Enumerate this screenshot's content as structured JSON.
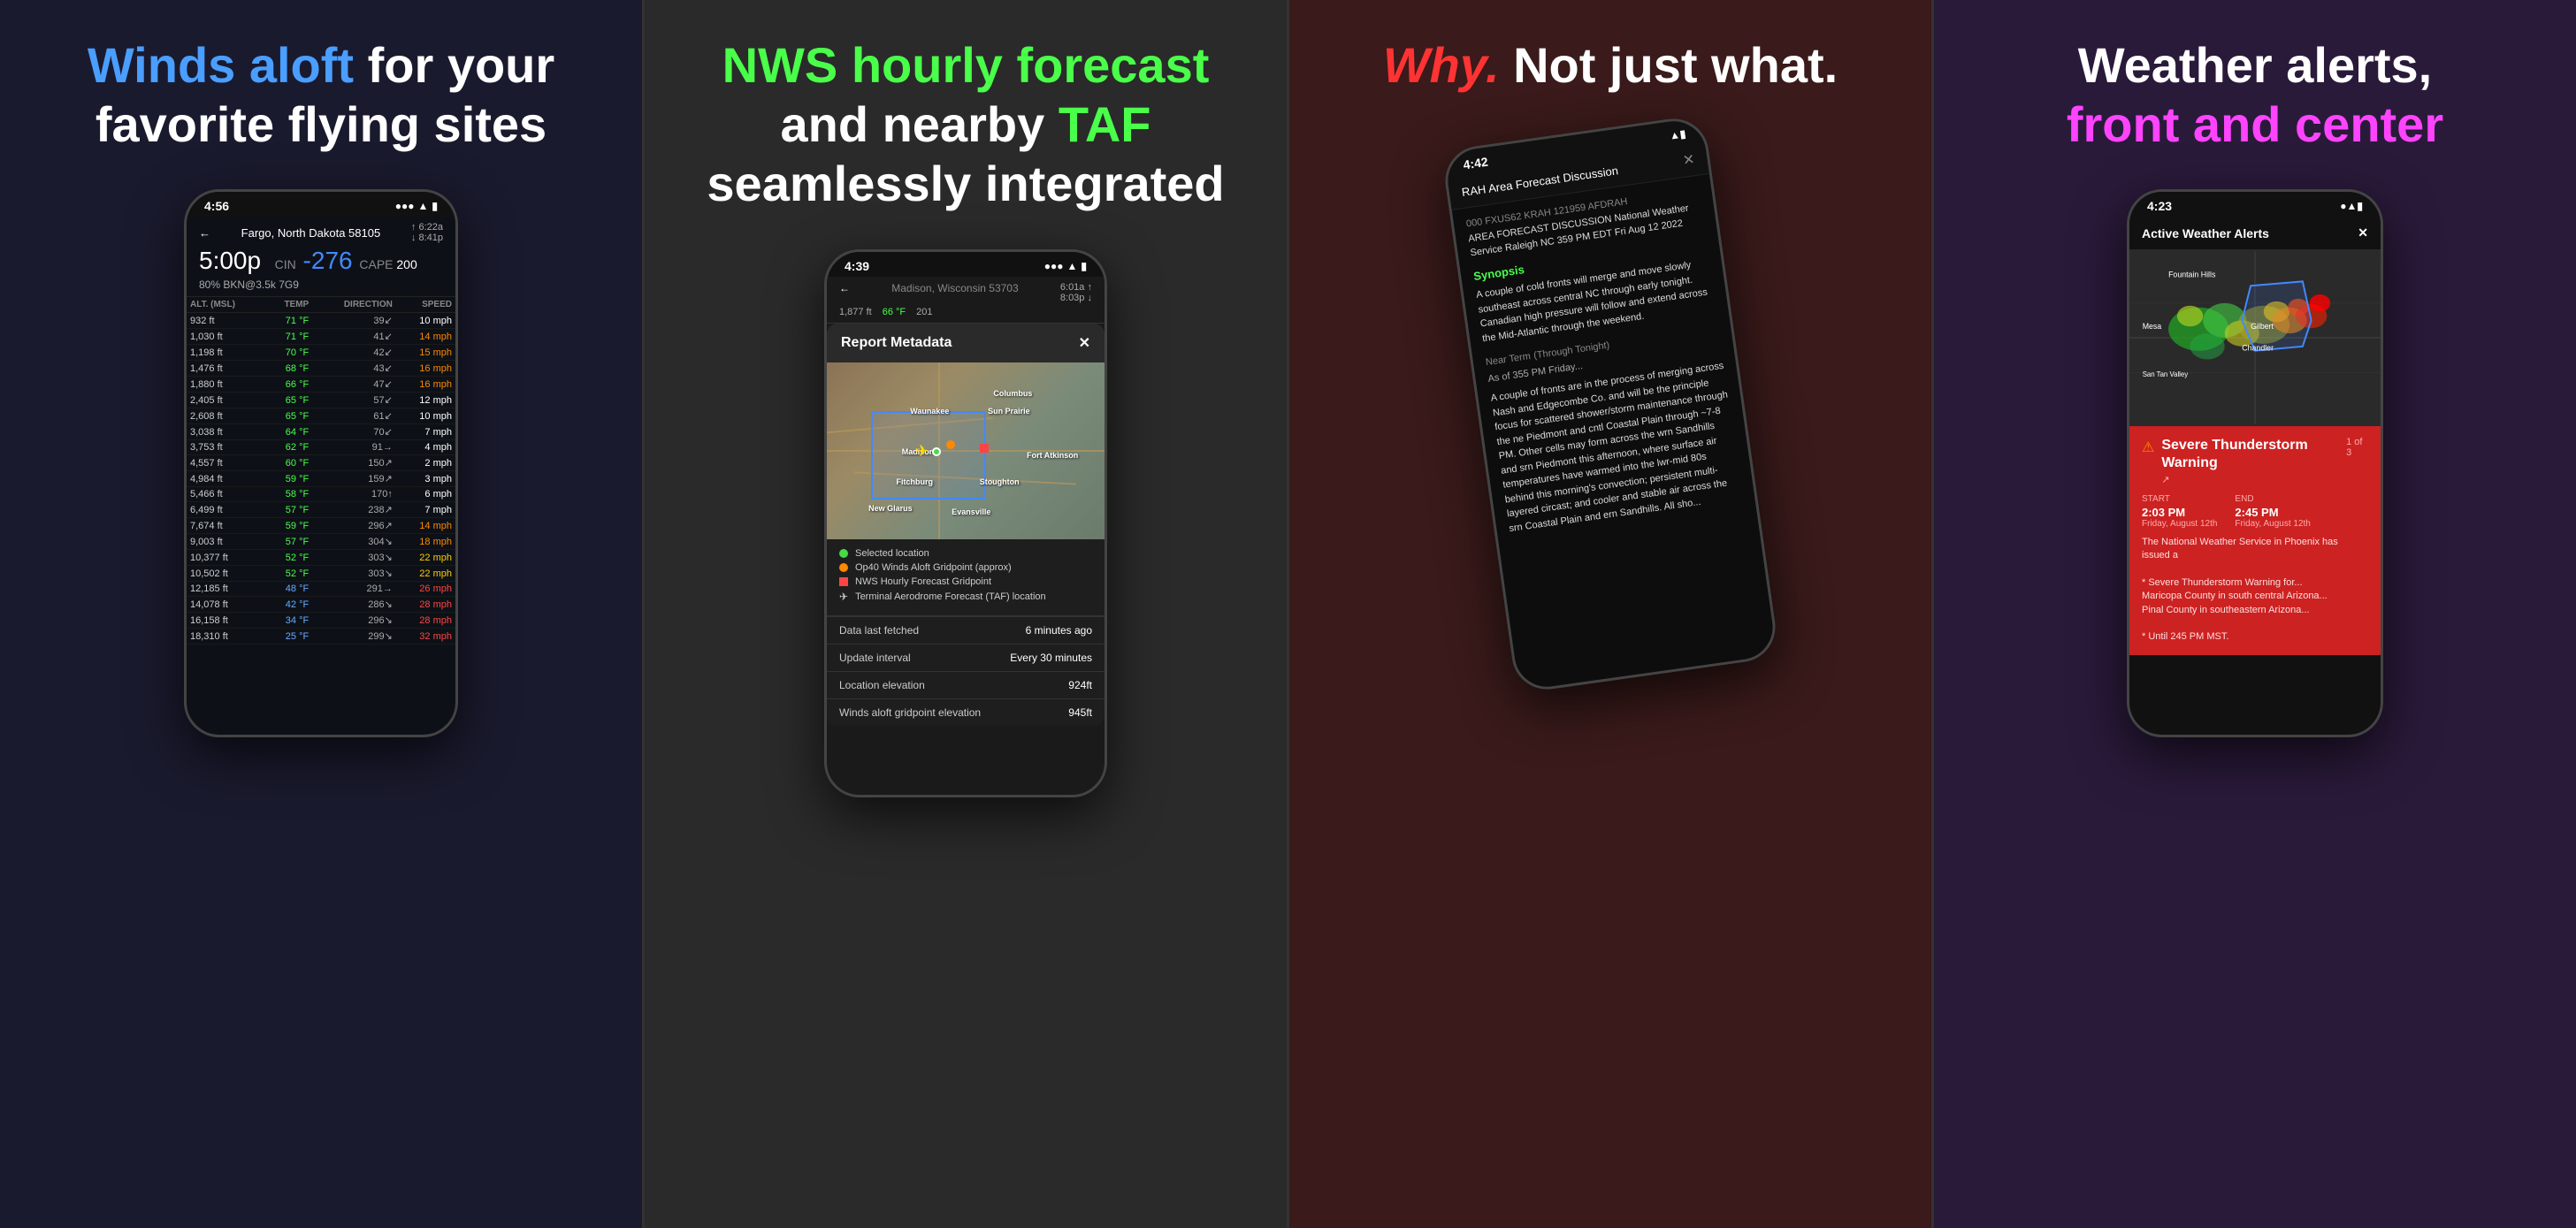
{
  "panels": [
    {
      "id": "panel-1",
      "bg": "#1a1a2e",
      "title_parts": [
        {
          "text": "Winds aloft",
          "color": "blue",
          "break": false
        },
        {
          "text": " for your\nfavorite flying sites",
          "color": "white",
          "break": false
        }
      ],
      "title_html": true,
      "phone": {
        "time": "4:56",
        "location": "Fargo, North Dakota 58105",
        "sunrise": "6:22a",
        "sunset": "8:41p",
        "display_time": "5:00p",
        "cin": "-276",
        "cape": "200",
        "sky": "80% BKN@3.5k 7G9",
        "table_headers": [
          "ALT. (MSL)",
          "TEMP",
          "DIRECTION",
          "SPEED"
        ],
        "rows": [
          {
            "alt": "932 ft",
            "temp": "71 °F",
            "dir": "39↙",
            "speed": "10 mph",
            "speed_color": "white"
          },
          {
            "alt": "1,030 ft",
            "temp": "71 °F",
            "dir": "41↙",
            "speed": "14 mph",
            "speed_color": "orange"
          },
          {
            "alt": "1,198 ft",
            "temp": "70 °F",
            "dir": "42↙",
            "speed": "15 mph",
            "speed_color": "orange"
          },
          {
            "alt": "1,476 ft",
            "temp": "68 °F",
            "dir": "43↙",
            "speed": "16 mph",
            "speed_color": "orange"
          },
          {
            "alt": "1,880 ft",
            "temp": "66 °F",
            "dir": "47↙",
            "speed": "16 mph",
            "speed_color": "orange"
          },
          {
            "alt": "2,405 ft",
            "temp": "65 °F",
            "dir": "57↙",
            "speed": "12 mph",
            "speed_color": "white"
          },
          {
            "alt": "2,608 ft",
            "temp": "65 °F",
            "dir": "61↙",
            "speed": "10 mph",
            "speed_color": "white"
          },
          {
            "alt": "3,038 ft",
            "temp": "64 °F",
            "dir": "70↙",
            "speed": "7 mph",
            "speed_color": "white"
          },
          {
            "alt": "3,753 ft",
            "temp": "62 °F",
            "dir": "91→",
            "speed": "4 mph",
            "speed_color": "white"
          },
          {
            "alt": "4,557 ft",
            "temp": "60 °F",
            "dir": "150↗",
            "speed": "2 mph",
            "speed_color": "white"
          },
          {
            "alt": "4,984 ft",
            "temp": "59 °F",
            "dir": "159↗",
            "speed": "3 mph",
            "speed_color": "white"
          },
          {
            "alt": "5,466 ft",
            "temp": "58 °F",
            "dir": "170↑",
            "speed": "6 mph",
            "speed_color": "white"
          },
          {
            "alt": "6,499 ft",
            "temp": "57 °F",
            "dir": "238↗",
            "speed": "7 mph",
            "speed_color": "white"
          },
          {
            "alt": "7,674 ft",
            "temp": "59 °F",
            "dir": "296↗",
            "speed": "14 mph",
            "speed_color": "orange"
          },
          {
            "alt": "9,003 ft",
            "temp": "57 °F",
            "dir": "304↘",
            "speed": "18 mph",
            "speed_color": "orange"
          },
          {
            "alt": "10,377 ft",
            "temp": "52 °F",
            "dir": "303↘",
            "speed": "22 mph",
            "speed_color": "yellow"
          },
          {
            "alt": "10,502 ft",
            "temp": "52 °F",
            "dir": "303↘",
            "speed": "22 mph",
            "speed_color": "yellow"
          },
          {
            "alt": "12,185 ft",
            "temp": "48 °F",
            "dir": "291→",
            "speed": "26 mph",
            "speed_color": "red"
          },
          {
            "alt": "14,078 ft",
            "temp": "42 °F",
            "dir": "286↘",
            "speed": "28 mph",
            "speed_color": "red"
          },
          {
            "alt": "16,158 ft",
            "temp": "34 °F",
            "dir": "296↘",
            "speed": "28 mph",
            "speed_color": "red"
          },
          {
            "alt": "18,310 ft",
            "temp": "25 °F",
            "dir": "299↘",
            "speed": "32 mph",
            "speed_color": "red"
          }
        ]
      }
    },
    {
      "id": "panel-2",
      "bg": "#2a2a2a",
      "title": "NWS hourly forecast and nearby TAF seamlessly integrated",
      "phone": {
        "time": "4:39",
        "location": "Madison, Wisconsin 53703",
        "alt": "1,877 ft",
        "temp": "66 °F",
        "rise": "201",
        "modal_title": "Report Metadata",
        "cities": [
          "Columbus",
          "Waunakee",
          "Sun Prairie",
          "Madison",
          "Fort Atkinson",
          "Fitchburg",
          "Stoughton",
          "New Glarus",
          "Evansville"
        ],
        "legend": [
          {
            "color": "#44DD44",
            "shape": "circle",
            "label": "Selected location"
          },
          {
            "color": "#FF8800",
            "shape": "circle",
            "label": "Op40 Winds Aloft Gridpoint (approx)"
          },
          {
            "color": "#FF4444",
            "shape": "square",
            "label": "NWS Hourly Forecast Gridpoint"
          },
          {
            "color": "#FFD700",
            "shape": "plane",
            "label": "Terminal Aerodrome Forecast (TAF) location"
          }
        ],
        "metadata": [
          {
            "label": "Data last fetched",
            "value": "6 minutes ago"
          },
          {
            "label": "Update interval",
            "value": "Every 30 minutes"
          },
          {
            "label": "Location elevation",
            "value": "924ft"
          },
          {
            "label": "Winds aloft gridpoint elevation",
            "value": "945ft"
          }
        ]
      }
    },
    {
      "id": "panel-3",
      "bg": "#2a1a0a",
      "title": "Why. Not just what.",
      "phone": {
        "time": "4:42",
        "header_title": "RAH Area Forecast Discussion",
        "forecast_id": "000 FXUS62 KRAH 121959 AFDRAH",
        "forecast_desc": "AREA FORECAST DISCUSSION National Weather Service Raleigh NC 359 PM EDT Fri Aug 12 2022",
        "synopsis_label": "Synopsis",
        "synopsis_text": "A couple of cold fronts will merge and move slowly southeast across central NC through early tonight. Canadian high pressure will follow and extend across the Mid-Atlantic through the weekend.",
        "nearterm_label": "Near Term",
        "nearterm_sub": "(Through Tonight)",
        "nearterm_intro": "As of 355 PM Friday...",
        "nearterm_text": "A couple of fronts are in the process of merging across Nash and Edgecombe Co. and will be the principle focus for scattered shower/storm maintenance through the ne Piedmont and cntl Coastal Plain through ~7-8 PM. Other cells may form across the wrn Sandhills and srn Piedmont this afternoon, where surface air temperatures have warmed into the lwr-mid 80s behind this morning's convection; persistent multi-layered circast; and cooler and stable air across the srn Coastal Plain and ern Sandhills. All sho..."
      }
    },
    {
      "id": "panel-4",
      "bg": "#2a1a3a",
      "title": "Weather alerts, front and center",
      "phone": {
        "time": "4:23",
        "alerts_title": "Active Weather Alerts",
        "alert": {
          "title": "Severe Thunderstorm Warning",
          "badge": "1 of 3",
          "start_label": "START",
          "start_time": "2:03 PM",
          "start_date": "Friday, August 12th",
          "end_label": "END",
          "end_time": "2:45 PM",
          "end_date": "Friday, August 12th",
          "body": "The National Weather Service in Phoenix has issued a\n\n* Severe Thunderstorm Warning for...\nMaricopa County in south central Arizona...\nPinal County in southeastern Arizona...\n\n* Until 245 PM MST."
        }
      }
    }
  ],
  "labels": {
    "panel1_title_line1_highlight": "Winds aloft",
    "panel1_title_line1_rest": " for your",
    "panel1_title_line2": "favorite flying sites",
    "panel2_title_line1_highlight": "NWS hourly forecast",
    "panel2_title_line2_start": "and nearby ",
    "panel2_title_line2_highlight": "TAF",
    "panel2_title_line3": "seamlessly integrated",
    "panel3_title_highlight": "Why.",
    "panel3_title_rest": " Not just what.",
    "panel4_title_line1": "Weather alerts,",
    "panel4_title_line2_highlight": "front and center"
  }
}
